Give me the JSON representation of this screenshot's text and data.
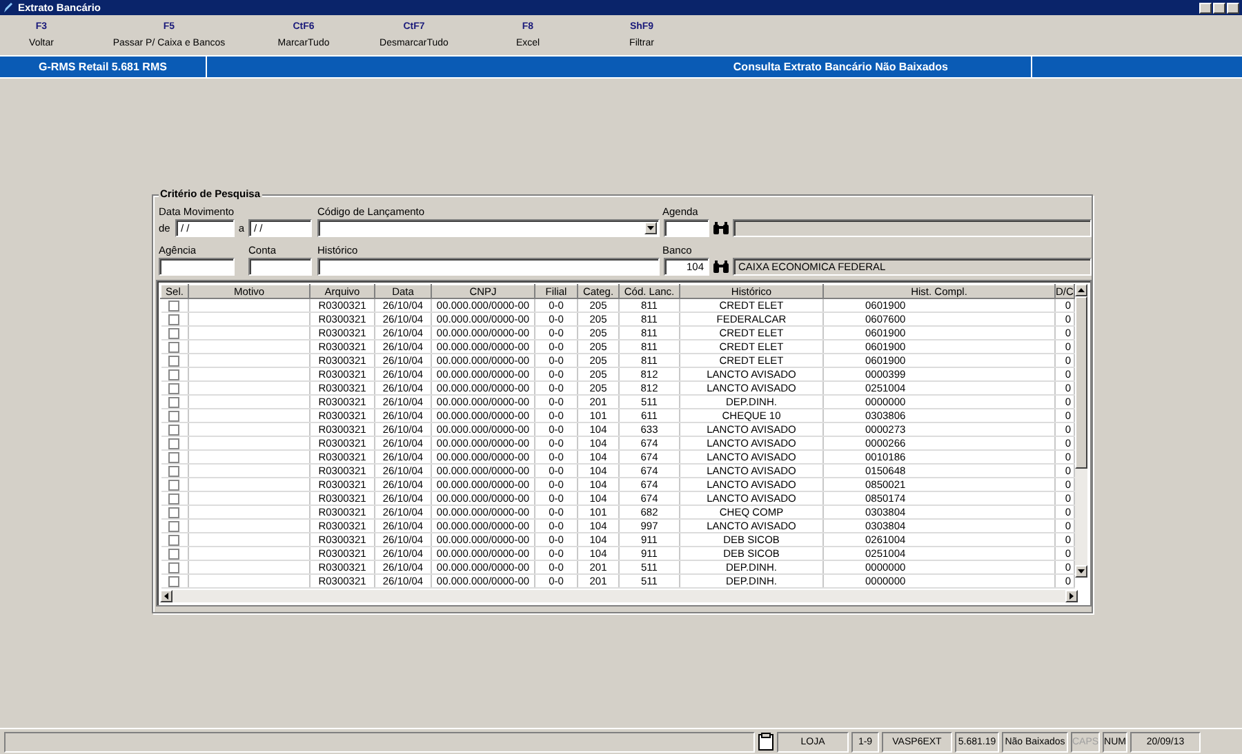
{
  "window": {
    "title": "Extrato Bancário"
  },
  "toolbar": [
    {
      "key": "F3",
      "label": "Voltar"
    },
    {
      "key": "F5",
      "label": "Passar P/ Caixa e Bancos"
    },
    {
      "key": "CtF6",
      "label": "MarcarTudo"
    },
    {
      "key": "CtF7",
      "label": "DesmarcarTudo"
    },
    {
      "key": "F8",
      "label": "Excel"
    },
    {
      "key": "ShF9",
      "label": "Filtrar"
    }
  ],
  "header_bar": {
    "app": "G-RMS Retail 5.681 RMS",
    "screen": "Consulta Extrato Bancário Não Baixados"
  },
  "search": {
    "title": "Critério de Pesquisa",
    "date_label": "Data Movimento",
    "from_label": "de",
    "from_value": "/ /",
    "to_label": "a",
    "to_value": "/ /",
    "code_label": "Código de Lançamento",
    "agenda_label": "Agenda",
    "agency_label": "Agência",
    "account_label": "Conta",
    "history_label": "Histórico",
    "bank_label": "Banco",
    "bank_value": "104",
    "bank_name": "CAIXA ECONOMICA FEDERAL"
  },
  "table": {
    "selection_column": "Sel.",
    "columns": [
      "Motivo",
      "Arquivo",
      "Data",
      "CNPJ",
      "Filial",
      "Categ.",
      "Cód. Lanc.",
      "Histórico",
      "Hist. Compl.",
      "D/C"
    ],
    "rows": [
      {
        "checked": false,
        "cells": [
          "",
          "R0300321",
          "26/10/04",
          "00.000.000/0000-00",
          "0-0",
          "205",
          "811",
          "CREDT ELET",
          "0601900",
          "0"
        ]
      },
      {
        "checked": false,
        "cells": [
          "",
          "R0300321",
          "26/10/04",
          "00.000.000/0000-00",
          "0-0",
          "205",
          "811",
          "FEDERALCAR",
          "0607600",
          "0"
        ]
      },
      {
        "checked": false,
        "cells": [
          "",
          "R0300321",
          "26/10/04",
          "00.000.000/0000-00",
          "0-0",
          "205",
          "811",
          "CREDT ELET",
          "0601900",
          "0"
        ]
      },
      {
        "checked": false,
        "cells": [
          "",
          "R0300321",
          "26/10/04",
          "00.000.000/0000-00",
          "0-0",
          "205",
          "811",
          "CREDT ELET",
          "0601900",
          "0"
        ]
      },
      {
        "checked": false,
        "cells": [
          "",
          "R0300321",
          "26/10/04",
          "00.000.000/0000-00",
          "0-0",
          "205",
          "811",
          "CREDT ELET",
          "0601900",
          "0"
        ]
      },
      {
        "checked": false,
        "cells": [
          "",
          "R0300321",
          "26/10/04",
          "00.000.000/0000-00",
          "0-0",
          "205",
          "812",
          "LANCTO AVISADO",
          "0000399",
          "0"
        ]
      },
      {
        "checked": false,
        "cells": [
          "",
          "R0300321",
          "26/10/04",
          "00.000.000/0000-00",
          "0-0",
          "205",
          "812",
          "LANCTO AVISADO",
          "0251004",
          "0"
        ]
      },
      {
        "checked": false,
        "cells": [
          "",
          "R0300321",
          "26/10/04",
          "00.000.000/0000-00",
          "0-0",
          "201",
          "511",
          "DEP.DINH.",
          "0000000",
          "0"
        ]
      },
      {
        "checked": false,
        "cells": [
          "",
          "R0300321",
          "26/10/04",
          "00.000.000/0000-00",
          "0-0",
          "101",
          "611",
          "CHEQUE  10",
          "0303806",
          "0"
        ]
      },
      {
        "checked": false,
        "cells": [
          "",
          "R0300321",
          "26/10/04",
          "00.000.000/0000-00",
          "0-0",
          "104",
          "633",
          "LANCTO AVISADO",
          "0000273",
          "0"
        ]
      },
      {
        "checked": false,
        "cells": [
          "",
          "R0300321",
          "26/10/04",
          "00.000.000/0000-00",
          "0-0",
          "104",
          "674",
          "LANCTO AVISADO",
          "0000266",
          "0"
        ]
      },
      {
        "checked": false,
        "cells": [
          "",
          "R0300321",
          "26/10/04",
          "00.000.000/0000-00",
          "0-0",
          "104",
          "674",
          "LANCTO AVISADO",
          "0010186",
          "0"
        ]
      },
      {
        "checked": false,
        "cells": [
          "",
          "R0300321",
          "26/10/04",
          "00.000.000/0000-00",
          "0-0",
          "104",
          "674",
          "LANCTO AVISADO",
          "0150648",
          "0"
        ]
      },
      {
        "checked": false,
        "cells": [
          "",
          "R0300321",
          "26/10/04",
          "00.000.000/0000-00",
          "0-0",
          "104",
          "674",
          "LANCTO AVISADO",
          "0850021",
          "0"
        ]
      },
      {
        "checked": false,
        "cells": [
          "",
          "R0300321",
          "26/10/04",
          "00.000.000/0000-00",
          "0-0",
          "104",
          "674",
          "LANCTO AVISADO",
          "0850174",
          "0"
        ]
      },
      {
        "checked": false,
        "cells": [
          "",
          "R0300321",
          "26/10/04",
          "00.000.000/0000-00",
          "0-0",
          "101",
          "682",
          "CHEQ COMP",
          "0303804",
          "0"
        ]
      },
      {
        "checked": false,
        "cells": [
          "",
          "R0300321",
          "26/10/04",
          "00.000.000/0000-00",
          "0-0",
          "104",
          "997",
          "LANCTO AVISADO",
          "0303804",
          "0"
        ]
      },
      {
        "checked": false,
        "cells": [
          "",
          "R0300321",
          "26/10/04",
          "00.000.000/0000-00",
          "0-0",
          "104",
          "911",
          "DEB SICOB",
          "0261004",
          "0"
        ]
      },
      {
        "checked": false,
        "cells": [
          "",
          "R0300321",
          "26/10/04",
          "00.000.000/0000-00",
          "0-0",
          "104",
          "911",
          "DEB SICOB",
          "0251004",
          "0"
        ]
      },
      {
        "checked": false,
        "cells": [
          "",
          "R0300321",
          "26/10/04",
          "00.000.000/0000-00",
          "0-0",
          "201",
          "511",
          "DEP.DINH.",
          "0000000",
          "0"
        ]
      },
      {
        "checked": false,
        "cells": [
          "",
          "R0300321",
          "26/10/04",
          "00.000.000/0000-00",
          "0-0",
          "201",
          "511",
          "DEP.DINH.",
          "0000000",
          "0"
        ]
      }
    ]
  },
  "status_bar": [
    {
      "text": "LOJA",
      "disabled": false
    },
    {
      "text": "1-9",
      "disabled": false
    },
    {
      "text": "VASP6EXT",
      "disabled": false
    },
    {
      "text": "5.681.19",
      "disabled": false
    },
    {
      "text": "Não Baixados",
      "disabled": false
    },
    {
      "text": "CAPS",
      "disabled": true
    },
    {
      "text": "NUM",
      "disabled": false
    },
    {
      "text": "20/09/13",
      "disabled": false
    }
  ]
}
